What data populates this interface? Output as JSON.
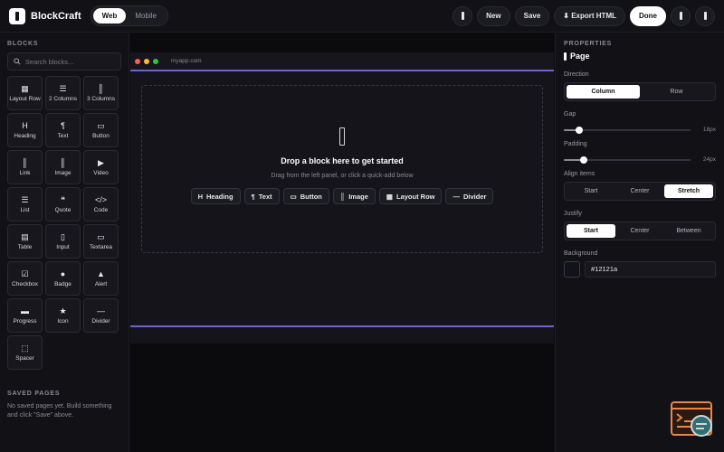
{
  "app": {
    "name": "BlockCraft",
    "modes": [
      "Web",
      "Mobile"
    ],
    "active_mode": "Web"
  },
  "topbar": {
    "new_label": "New",
    "save_label": "Save",
    "export_label": "⬇ Export HTML",
    "done_label": "Done"
  },
  "blocks": {
    "heading": "BLOCKS",
    "search_placeholder": "Search blocks...",
    "items": [
      {
        "label": "Layout Row",
        "glyph": "▦",
        "icon": "layout-row-icon"
      },
      {
        "label": "2 Columns",
        "glyph": "☰",
        "icon": "two-columns-icon"
      },
      {
        "label": "3 Columns",
        "glyph": "║",
        "icon": "three-columns-icon"
      },
      {
        "label": "Heading",
        "glyph": "H",
        "icon": "heading-icon"
      },
      {
        "label": "Text",
        "glyph": "¶",
        "icon": "text-icon"
      },
      {
        "label": "Button",
        "glyph": "▭",
        "icon": "button-icon"
      },
      {
        "label": "Link",
        "glyph": "║",
        "icon": "link-icon"
      },
      {
        "label": "Image",
        "glyph": "║",
        "icon": "image-icon"
      },
      {
        "label": "Video",
        "glyph": "▶",
        "icon": "video-icon"
      },
      {
        "label": "List",
        "glyph": "☰",
        "icon": "list-icon"
      },
      {
        "label": "Quote",
        "glyph": "❝",
        "icon": "quote-icon"
      },
      {
        "label": "Code",
        "glyph": "</>",
        "icon": "code-icon"
      },
      {
        "label": "Table",
        "glyph": "▤",
        "icon": "table-icon"
      },
      {
        "label": "Input",
        "glyph": "▯",
        "icon": "input-icon"
      },
      {
        "label": "Textarea",
        "glyph": "▭",
        "icon": "textarea-icon"
      },
      {
        "label": "Checkbox",
        "glyph": "☑",
        "icon": "checkbox-icon"
      },
      {
        "label": "Badge",
        "glyph": "●",
        "icon": "badge-icon"
      },
      {
        "label": "Alert",
        "glyph": "▲",
        "icon": "alert-icon"
      },
      {
        "label": "Progress",
        "glyph": "▬",
        "icon": "progress-icon"
      },
      {
        "label": "Icon",
        "glyph": "★",
        "icon": "star-icon"
      },
      {
        "label": "Divider",
        "glyph": "—",
        "icon": "divider-icon"
      },
      {
        "label": "Spacer",
        "glyph": "⬚",
        "icon": "spacer-icon"
      }
    ]
  },
  "saved_pages": {
    "heading": "SAVED PAGES",
    "empty_text": "No saved pages yet. Build something and click \"Save\" above."
  },
  "canvas": {
    "url": "myapp.com",
    "drop_title": "Drop a block here to get started",
    "drop_subtitle": "Drag from the left panel, or click a quick-add below",
    "quick_add": [
      {
        "label": "Heading",
        "glyph": "H",
        "icon": "heading-icon"
      },
      {
        "label": "Text",
        "glyph": "¶",
        "icon": "text-icon"
      },
      {
        "label": "Button",
        "glyph": "▭",
        "icon": "button-icon"
      },
      {
        "label": "Image",
        "glyph": "║",
        "icon": "image-icon"
      },
      {
        "label": "Layout Row",
        "glyph": "▦",
        "icon": "layout-row-icon"
      },
      {
        "label": "Divider",
        "glyph": "—",
        "icon": "divider-icon"
      }
    ]
  },
  "properties": {
    "heading": "PROPERTIES",
    "title": "Page",
    "direction": {
      "label": "Direction",
      "options": [
        "Column",
        "Row"
      ],
      "selected": "Column"
    },
    "gap": {
      "label": "Gap",
      "value": "18px",
      "fraction": 0.12
    },
    "padding": {
      "label": "Padding",
      "value": "24px",
      "fraction": 0.16
    },
    "align_items": {
      "label": "Align items",
      "options": [
        "Start",
        "Center",
        "Stretch"
      ],
      "selected": "Stretch"
    },
    "justify": {
      "label": "Justify",
      "options": [
        "Start",
        "Center",
        "Between"
      ],
      "selected": "Start"
    },
    "background": {
      "label": "Background",
      "value": "#12121a"
    }
  },
  "colors": {
    "accent": "#6e62d6",
    "dot_red": "#ff5f57",
    "dot_yellow": "#febc2e",
    "dot_green": "#28c840",
    "widget_orange": "#e8874a",
    "widget_teal": "#2f6f73"
  }
}
